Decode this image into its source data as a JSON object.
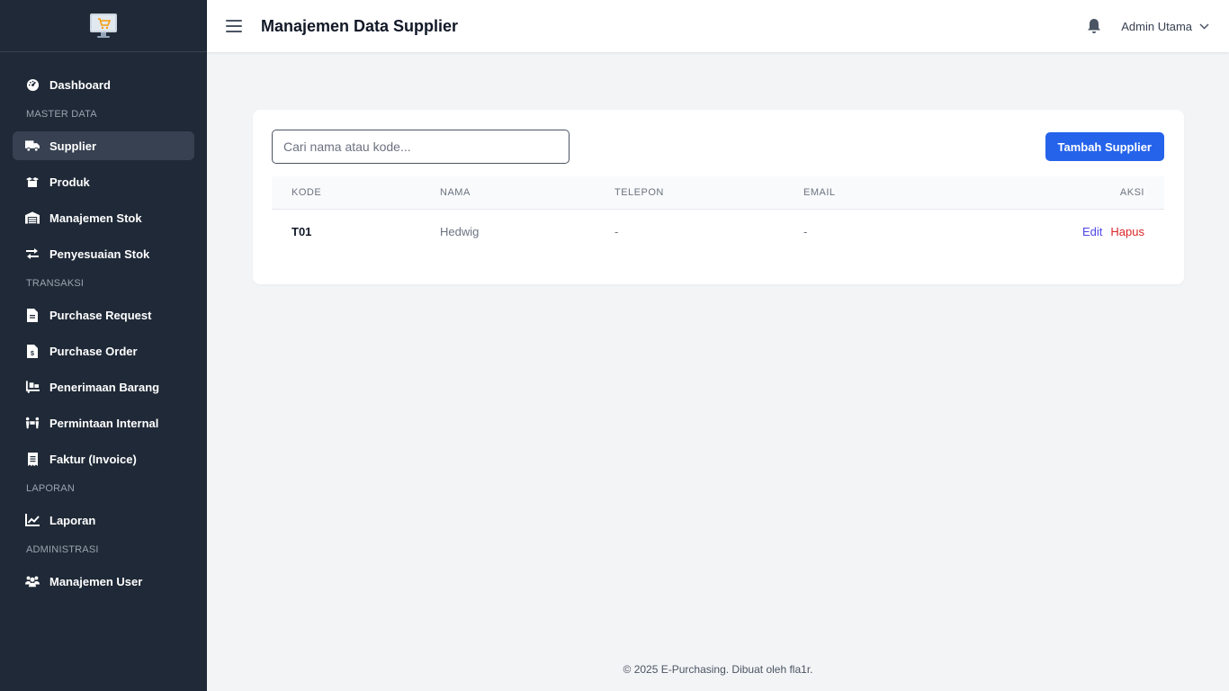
{
  "sidebar": {
    "items": [
      {
        "label": "Dashboard",
        "icon": "gauge-icon"
      },
      {
        "section": "MASTER DATA"
      },
      {
        "label": "Supplier",
        "icon": "truck-icon",
        "active": true
      },
      {
        "label": "Produk",
        "icon": "box-icon"
      },
      {
        "label": "Manajemen Stok",
        "icon": "warehouse-icon"
      },
      {
        "label": "Penyesuaian Stok",
        "icon": "exchange-icon"
      },
      {
        "section": "TRANSAKSI"
      },
      {
        "label": "Purchase Request",
        "icon": "file-icon"
      },
      {
        "label": "Purchase Order",
        "icon": "file-invoice-icon"
      },
      {
        "label": "Penerimaan Barang",
        "icon": "dolly-icon"
      },
      {
        "label": "Permintaan Internal",
        "icon": "people-carry-icon"
      },
      {
        "label": "Faktur (Invoice)",
        "icon": "receipt-icon"
      },
      {
        "section": "LAPORAN"
      },
      {
        "label": "Laporan",
        "icon": "chart-line-icon"
      },
      {
        "section": "ADMINISTRASI"
      },
      {
        "label": "Manajemen User",
        "icon": "users-icon"
      }
    ]
  },
  "header": {
    "title": "Manajemen Data Supplier",
    "user_name": "Admin Utama"
  },
  "toolbar": {
    "search_placeholder": "Cari nama atau kode...",
    "add_label": "Tambah Supplier"
  },
  "table": {
    "columns": [
      "KODE",
      "NAMA",
      "TELEPON",
      "EMAIL",
      "AKSI"
    ],
    "rows": [
      {
        "kode": "T01",
        "nama": "Hedwig",
        "telepon": "-",
        "email": "-",
        "edit": "Edit",
        "hapus": "Hapus"
      }
    ]
  },
  "footer": {
    "text": "© 2025 E-Purchasing. Dibuat oleh fla1r."
  },
  "colors": {
    "sidebar_bg": "#1f2937",
    "accent": "#2563eb",
    "edit": "#4f46e5",
    "delete": "#dc2626"
  }
}
